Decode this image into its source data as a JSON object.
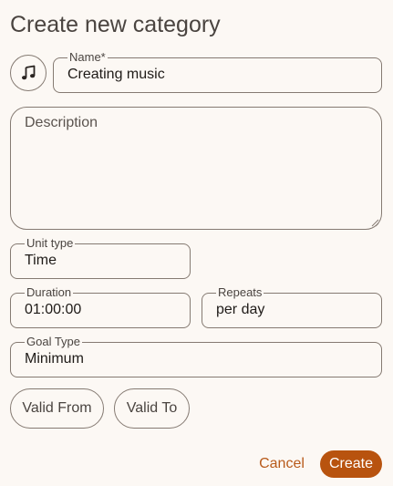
{
  "dialog": {
    "title": "Create new category",
    "icon": "music-note-icon"
  },
  "fields": {
    "name": {
      "label": "Name*",
      "value": "Creating music"
    },
    "description": {
      "placeholder": "Description",
      "value": ""
    },
    "unit_type": {
      "label": "Unit type",
      "value": "Time"
    },
    "duration": {
      "label": "Duration",
      "value": "01:00:00"
    },
    "repeats": {
      "label": "Repeats",
      "value": "per day"
    },
    "goal_type": {
      "label": "Goal Type",
      "value": "Minimum"
    }
  },
  "buttons": {
    "valid_from": "Valid From",
    "valid_to": "Valid To",
    "cancel": "Cancel",
    "create": "Create"
  },
  "colors": {
    "background": "#fcf8f4",
    "outline": "#857a72",
    "accent": "#b8530f"
  }
}
